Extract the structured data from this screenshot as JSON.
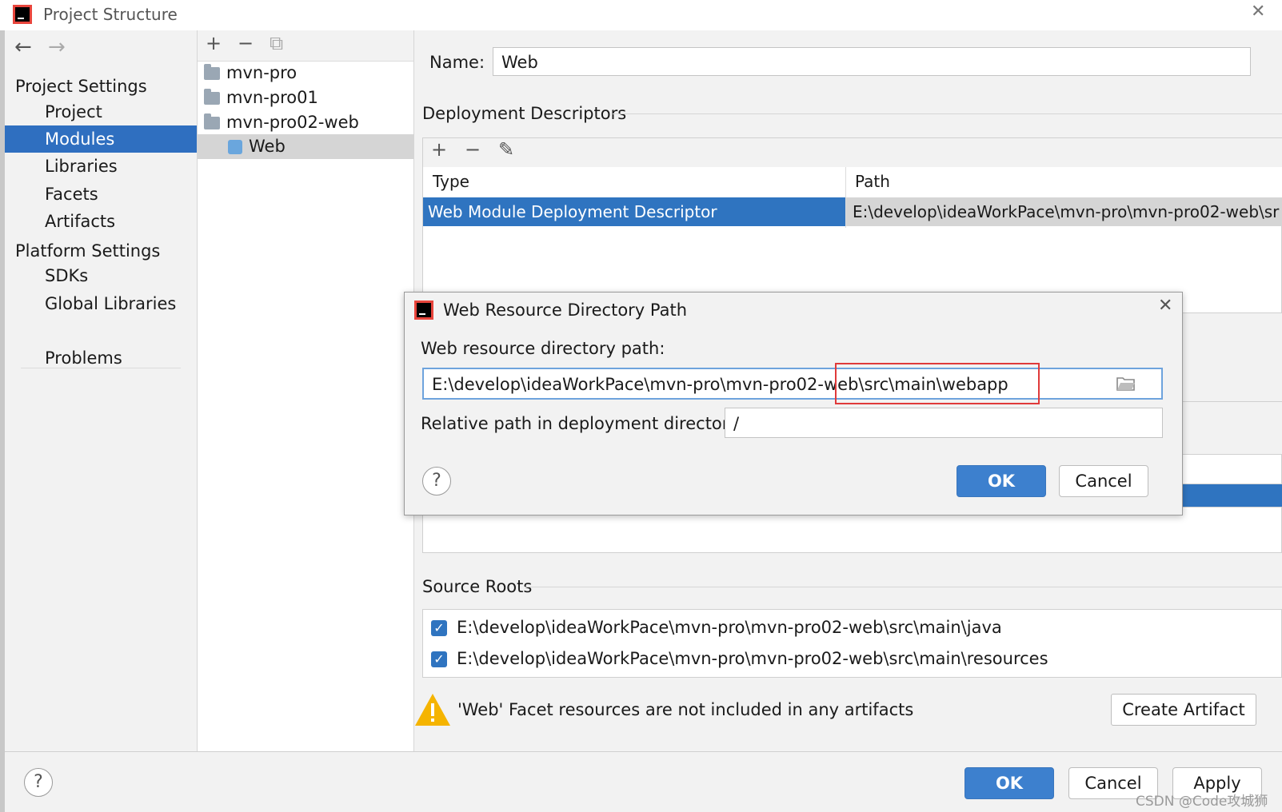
{
  "window": {
    "title": "Project Structure",
    "close": "✕"
  },
  "nav": {
    "back": "←",
    "forward": "→"
  },
  "sidebar": {
    "project_settings": "Project Settings",
    "items": [
      {
        "label": "Project"
      },
      {
        "label": "Modules"
      },
      {
        "label": "Libraries"
      },
      {
        "label": "Facets"
      },
      {
        "label": "Artifacts"
      }
    ],
    "platform_settings": "Platform Settings",
    "platform_items": [
      {
        "label": "SDKs"
      },
      {
        "label": "Global Libraries"
      }
    ],
    "problems": "Problems"
  },
  "tree": {
    "toolbar": {
      "add": "+",
      "remove": "−",
      "copy": "⧉"
    },
    "nodes": [
      {
        "label": "mvn-pro"
      },
      {
        "label": "mvn-pro01"
      },
      {
        "label": "mvn-pro02-web"
      },
      {
        "label": "Web"
      }
    ]
  },
  "facet": {
    "name_label": "Name:",
    "name_value": "Web",
    "deployment_title": "Deployment Descriptors",
    "dd_toolbar": {
      "add": "+",
      "remove": "−",
      "edit": "✎"
    },
    "dd_columns": {
      "type": "Type",
      "path": "Path"
    },
    "dd_row": {
      "type": "Web Module Deployment Descriptor",
      "path": "E:\\develop\\ideaWorkPace\\mvn-pro\\mvn-pro02-web\\sr"
    },
    "source_roots_title": "Source Roots",
    "source_roots": [
      {
        "path": "E:\\develop\\ideaWorkPace\\mvn-pro\\mvn-pro02-web\\src\\main\\java"
      },
      {
        "path": "E:\\develop\\ideaWorkPace\\mvn-pro\\mvn-pro02-web\\src\\main\\resources"
      }
    ],
    "warning": "'Web' Facet resources are not included in any artifacts",
    "create_artifact": "Create Artifact"
  },
  "dialog": {
    "title": "Web Resource Directory Path",
    "close": "✕",
    "path_label": "Web resource directory path:",
    "path_value": "E:\\develop\\ideaWorkPace\\mvn-pro\\mvn-pro02-web\\src\\main\\webapp",
    "relative_label": "Relative path in deployment directory:",
    "relative_value": "/",
    "help": "?",
    "ok": "OK",
    "cancel": "Cancel"
  },
  "footer": {
    "help": "?",
    "ok": "OK",
    "cancel": "Cancel",
    "apply": "Apply",
    "watermark": "CSDN @Code攻城狮"
  },
  "colors": {
    "selection": "#2f6fc0",
    "highlight": "#e03a3a",
    "primary_button": "#3d80ce"
  }
}
